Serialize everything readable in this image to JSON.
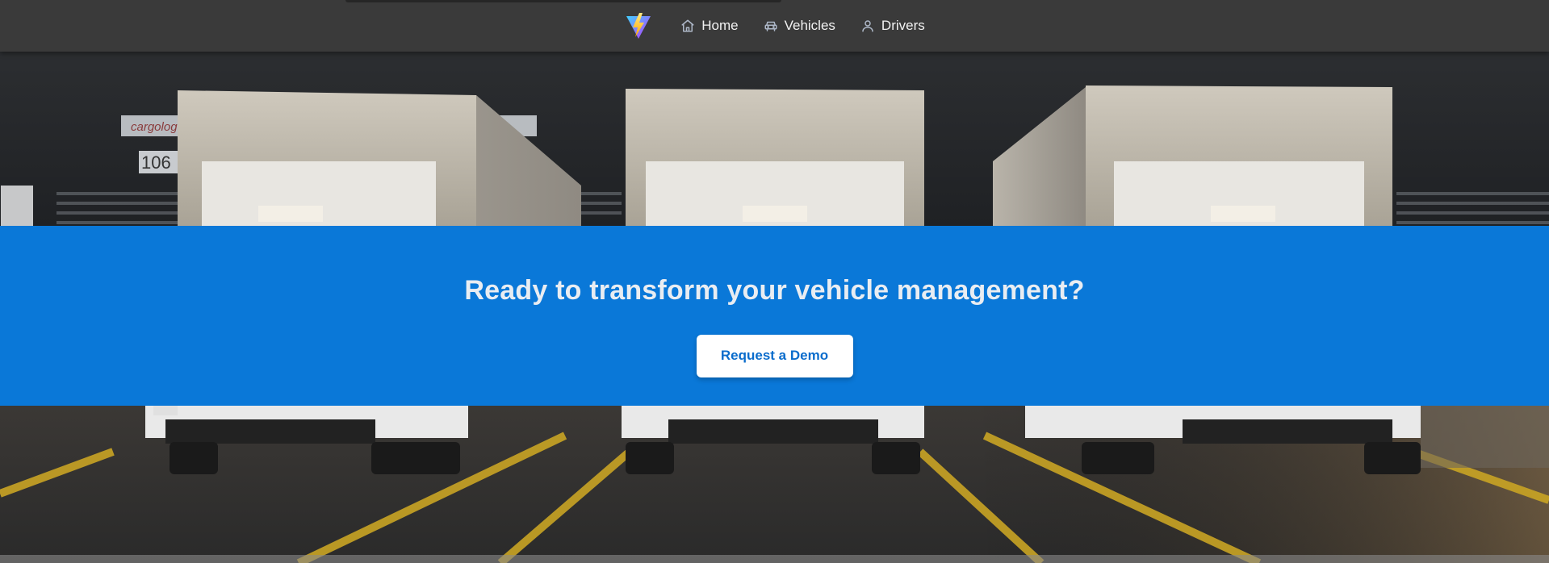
{
  "nav": {
    "logo_icon": "vite-logo-icon",
    "items": [
      {
        "label": "Home",
        "icon": "home-icon"
      },
      {
        "label": "Vehicles",
        "icon": "car-icon"
      },
      {
        "label": "Drivers",
        "icon": "user-icon"
      }
    ]
  },
  "hero": {
    "background_image": "photo of three white trucks at loading docks",
    "dock_signs": [
      "cargolog",
      "106"
    ]
  },
  "cta": {
    "title": "Ready to transform your vehicle management?",
    "button_label": "Request a Demo"
  },
  "colors": {
    "navbar_bg": "#3a3a3a",
    "cta_bg": "#0a78d8",
    "cta_button_text": "#0a6ccc"
  }
}
